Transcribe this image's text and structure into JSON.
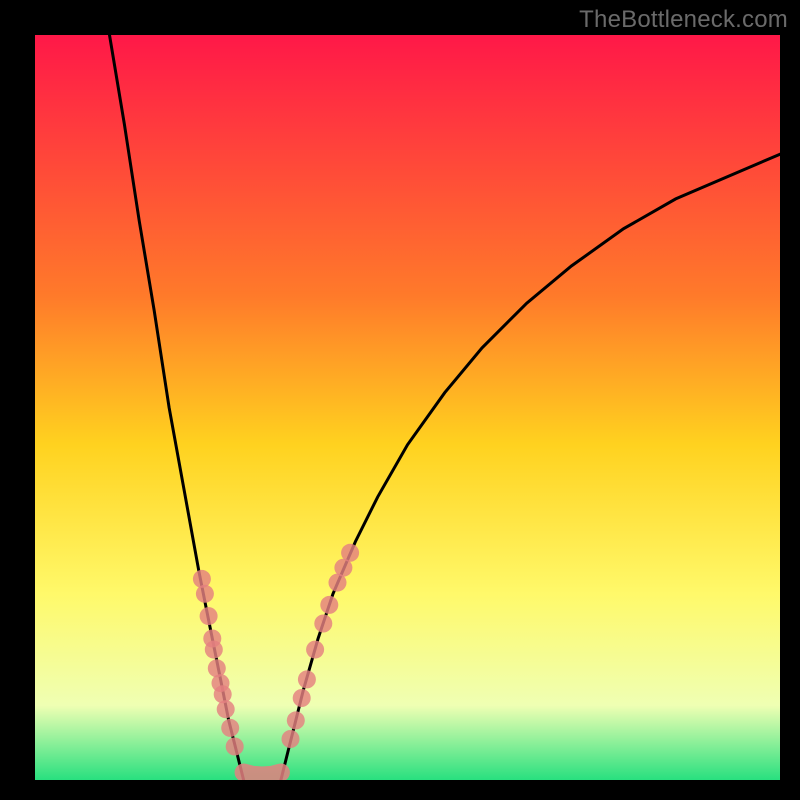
{
  "watermark": "TheBottleneck.com",
  "colors": {
    "frame": "#000000",
    "grad_top": "#ff1848",
    "grad_mid1": "#ff7a2a",
    "grad_mid2": "#ffd21f",
    "grad_mid3": "#fff96a",
    "grad_mid4": "#efffb3",
    "grad_bottom": "#28e07f",
    "curve": "#000000",
    "dot": "#e48080"
  },
  "chart_data": {
    "type": "line",
    "title": "",
    "xlabel": "",
    "ylabel": "",
    "xlim": [
      0,
      100
    ],
    "ylim": [
      0,
      100
    ],
    "curve_left": {
      "x": [
        10,
        12,
        14,
        16,
        18,
        20,
        22,
        23,
        24,
        25,
        26,
        27,
        28
      ],
      "y": [
        100,
        88,
        75,
        63,
        50,
        39,
        28,
        23,
        18,
        13,
        8,
        4,
        0
      ]
    },
    "curve_right": {
      "x": [
        33,
        34,
        35,
        36,
        38,
        40,
        43,
        46,
        50,
        55,
        60,
        66,
        72,
        79,
        86,
        93,
        100
      ],
      "y": [
        0,
        4,
        8,
        12,
        19,
        25,
        32,
        38,
        45,
        52,
        58,
        64,
        69,
        74,
        78,
        81,
        84
      ]
    },
    "flat_segment": {
      "x": [
        28,
        33
      ],
      "y": [
        0,
        0
      ]
    },
    "dots_left": [
      {
        "x": 22.8,
        "y": 25.0
      },
      {
        "x": 22.4,
        "y": 27.0
      },
      {
        "x": 23.3,
        "y": 22.0
      },
      {
        "x": 23.8,
        "y": 19.0
      },
      {
        "x": 24.0,
        "y": 17.5
      },
      {
        "x": 24.4,
        "y": 15.0
      },
      {
        "x": 24.9,
        "y": 13.0
      },
      {
        "x": 25.2,
        "y": 11.5
      },
      {
        "x": 25.6,
        "y": 9.5
      },
      {
        "x": 26.2,
        "y": 7.0
      },
      {
        "x": 26.8,
        "y": 4.5
      }
    ],
    "dots_right": [
      {
        "x": 34.3,
        "y": 5.5
      },
      {
        "x": 35.0,
        "y": 8.0
      },
      {
        "x": 35.8,
        "y": 11.0
      },
      {
        "x": 36.5,
        "y": 13.5
      },
      {
        "x": 37.6,
        "y": 17.5
      },
      {
        "x": 38.7,
        "y": 21.0
      },
      {
        "x": 39.5,
        "y": 23.5
      },
      {
        "x": 40.6,
        "y": 26.5
      },
      {
        "x": 41.4,
        "y": 28.5
      },
      {
        "x": 42.3,
        "y": 30.5
      }
    ],
    "dots_bottom": [
      {
        "x": 28.0,
        "y": 1.0
      },
      {
        "x": 29.2,
        "y": 0.7
      },
      {
        "x": 30.5,
        "y": 0.6
      },
      {
        "x": 31.8,
        "y": 0.7
      },
      {
        "x": 33.0,
        "y": 1.0
      }
    ]
  }
}
